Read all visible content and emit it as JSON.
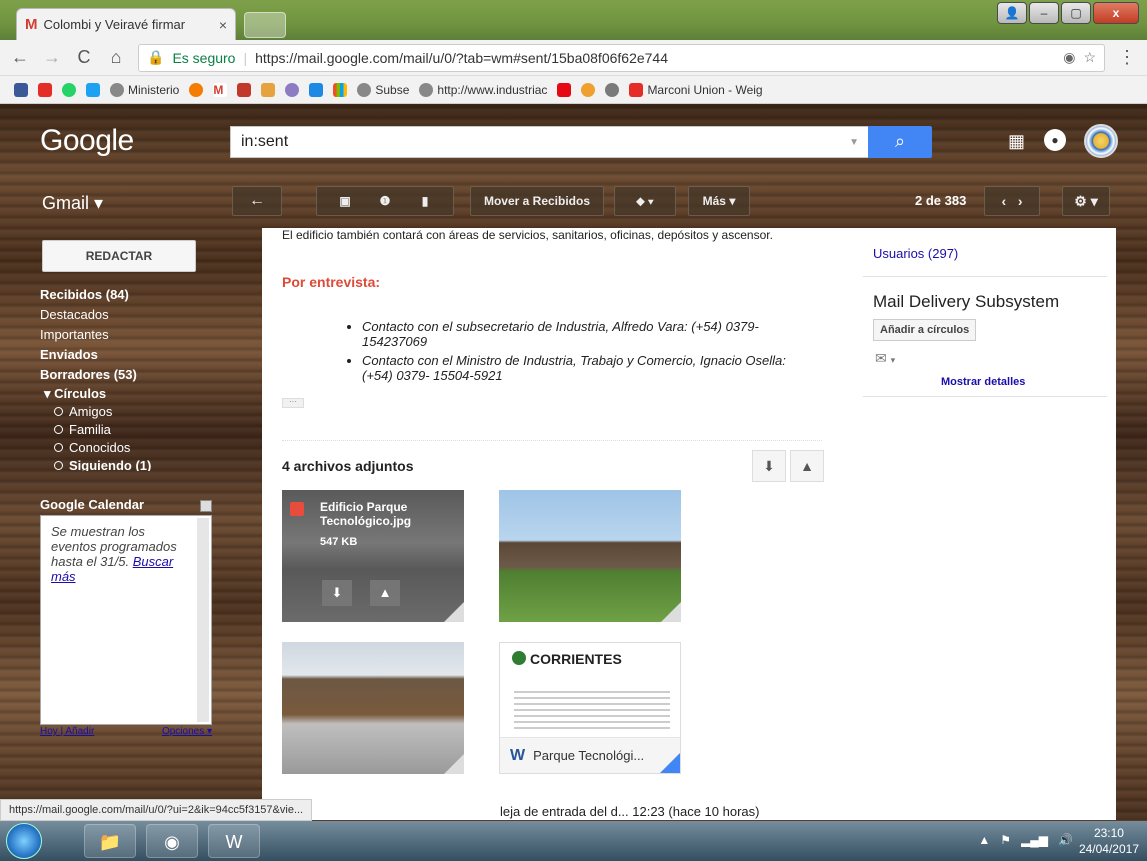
{
  "browser": {
    "tab_title": "Colombi y Veiravé firmar",
    "tab_close": "×",
    "secure_label": "Es seguro",
    "url": "https://mail.google.com/mail/u/0/?tab=wm#sent/15ba08f06f62e744",
    "bookmarks": [
      "Ministerio",
      "Subse",
      "http://www.industriac",
      "Marconi Union - Weig"
    ],
    "status_url": "https://mail.google.com/mail/u/0/?ui=2&ik=94cc5f3157&vie..."
  },
  "gmail": {
    "logo": "Google",
    "search_value": "in:sent",
    "product_label": "Gmail ▾",
    "compose_label": "REDACTAR",
    "nav": [
      {
        "label": "Recibidos (84)",
        "bold": true
      },
      {
        "label": "Destacados",
        "bold": false
      },
      {
        "label": "Importantes",
        "bold": false
      },
      {
        "label": "Enviados",
        "bold": true
      },
      {
        "label": "Borradores (53)",
        "bold": true
      }
    ],
    "circles_label": "▾ Círculos",
    "circles": [
      "Amigos",
      "Familia",
      "Conocidos",
      "Siguiendo (1)"
    ],
    "toolbar": {
      "move_inbox": "Mover a Recibidos",
      "more": "Más ▾",
      "pager": "2 de 383"
    },
    "calendar": {
      "title": "Google Calendar",
      "text": "Se muestran los eventos programados hasta el 31/5.",
      "link": "Buscar más",
      "footer_left": "Hoy | Añadir",
      "footer_right": "Opciones ▾"
    }
  },
  "message": {
    "top_text": "El edificio también contará con áreas de servicios, sanitarios, oficinas, depósitos y ascensor.",
    "interview_heading": "Por entrevista:",
    "contacts": [
      "Contacto con el subsecretario de Industria, Alfredo Vara: (+54) 0379-154237069",
      "Contacto con el Ministro de Industria, Trabajo y Comercio, Ignacio Osella: (+54) 0379- 15504-5921"
    ],
    "ellipsis": "···",
    "attachments_title": "4 archivos adjuntos",
    "attachment_1_name": "Edificio Parque Tecnológico.jpg",
    "attachment_1_size": "547 KB",
    "attachment_4_header": "CORRIENTES",
    "attachment_4_name": "Parque Tecnológi...",
    "bottom_text": "leja de entrada del d...  12:23 (hace 10 horas)"
  },
  "side": {
    "users_link": "Usuarios (297)",
    "sender_name": "Mail Delivery Subsystem",
    "add_circles": "Añadir a círculos",
    "show_details": "Mostrar detalles"
  },
  "taskbar": {
    "time": "23:10",
    "date": "24/04/2017"
  },
  "colors": {
    "gmail_red": "#dd4b39",
    "search_blue": "#4285f4",
    "link_blue": "#1a0dab"
  }
}
